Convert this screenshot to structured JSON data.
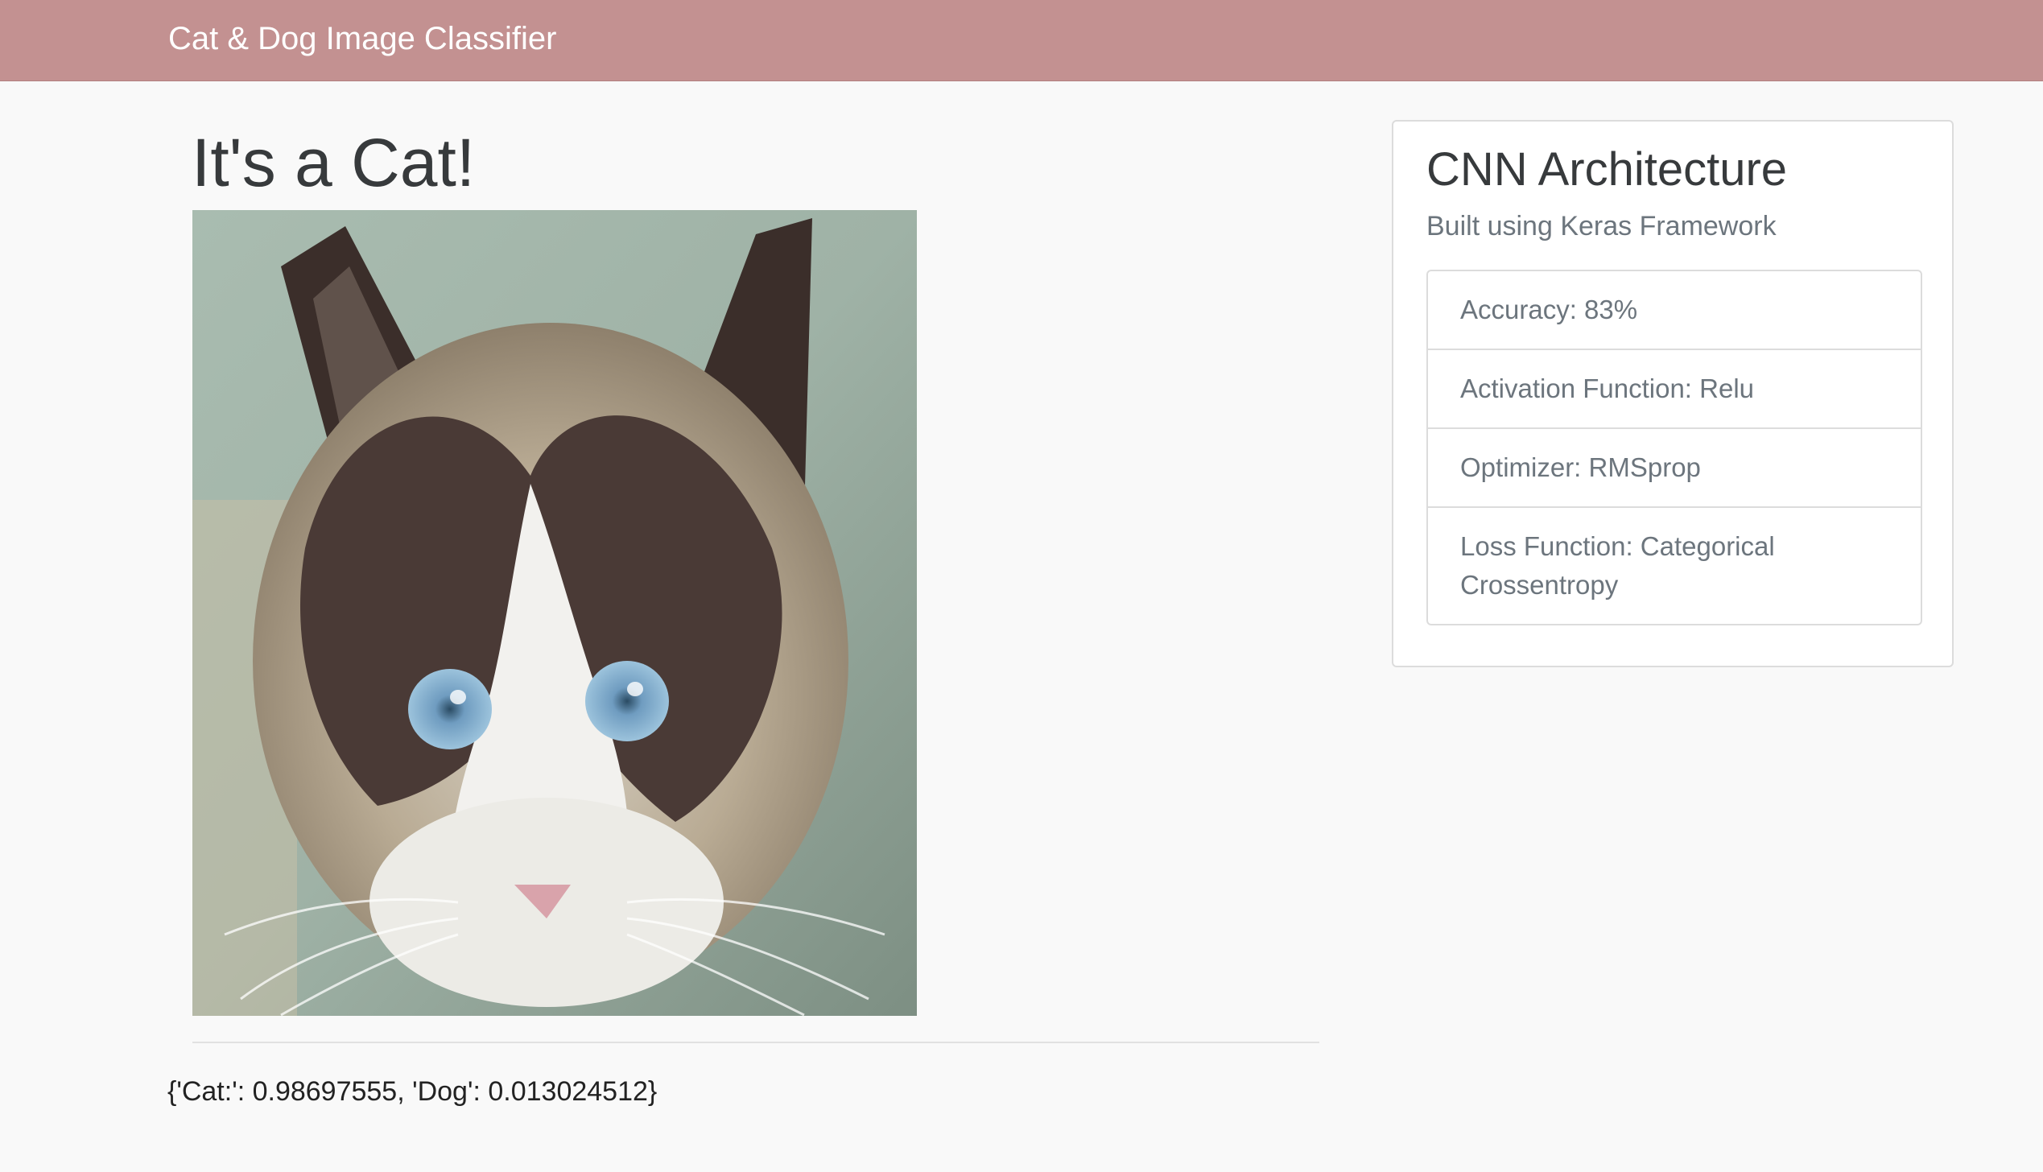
{
  "navbar": {
    "brand": "Cat & Dog Image Classifier"
  },
  "result": {
    "heading": "It's a Cat!",
    "image_alt": "cat photo",
    "probabilities": "{'Cat:': 0.98697555, 'Dog': 0.013024512}"
  },
  "model_card": {
    "title": "CNN Architecture",
    "subtitle": "Built using Keras Framework",
    "items": [
      {
        "label": "Accuracy: 83%"
      },
      {
        "label": "Activation Function: Relu"
      },
      {
        "label": "Optimizer: RMSprop"
      },
      {
        "label": "Loss Function: Categorical Crossentropy"
      }
    ]
  },
  "colors": {
    "navbar": "#c39191",
    "background": "#f9f9f9",
    "card_border": "#dcdcdc",
    "muted_text": "#6c757d"
  }
}
